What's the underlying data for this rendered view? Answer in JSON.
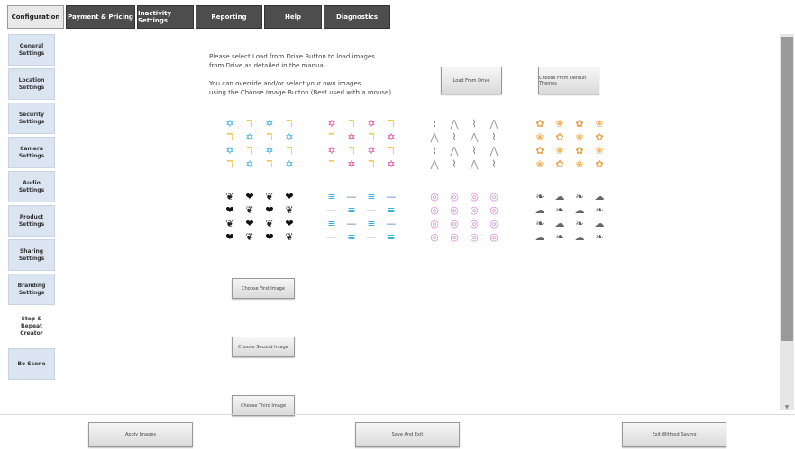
{
  "tabs": [
    {
      "label": "Configuration",
      "active": true
    },
    {
      "label": "Payment & Pricing",
      "active": false
    },
    {
      "label": "Inactivity Settings",
      "active": false
    },
    {
      "label": "Reporting",
      "active": false
    },
    {
      "label": "Help",
      "active": false
    },
    {
      "label": "Diagnostics",
      "active": false
    }
  ],
  "sidebar": {
    "items": [
      {
        "label": "General\nSettings"
      },
      {
        "label": "Location\nSettings"
      },
      {
        "label": "Security\nSettings"
      },
      {
        "label": "Camera\nSettings"
      },
      {
        "label": "Audio\nSettings"
      },
      {
        "label": "Product\nSettings"
      },
      {
        "label": "Sharing\nSettings"
      },
      {
        "label": "Branding\nSettings"
      },
      {
        "label": "Step &\nRepeat\nCreator"
      },
      {
        "label": "Bo Scene"
      }
    ]
  },
  "instructions": {
    "line1": "Please select Load from Drive Button to load images\nfrom Drive as detailed in the manual.",
    "line2": "You can override and/or select your own images\nusing the Choose Image Button (Best used with a mouse)."
  },
  "buttons": {
    "load_from_drive": "Load From Drive",
    "choose_default": "Choose From Default Themes",
    "choose_first": "Choose First Image",
    "choose_second": "Choose Second Image",
    "choose_third": "Choose Third Image",
    "apply_images": "Apply Images",
    "save_and_exit": "Save And Exit",
    "exit_without_saving": "Exit Without Saving"
  },
  "patterns": [
    {
      "glyphs": [
        "✡",
        "ℸ"
      ],
      "color": "#2aa9d6",
      "alt_color": "#f2b81f"
    },
    {
      "glyphs": [
        "✡",
        "ℸ"
      ],
      "color": "#e03ca0",
      "alt_color": "#f2b81f"
    },
    {
      "glyphs": [
        "⌇",
        "⋀"
      ],
      "color": "#777777",
      "alt_color": "#999999"
    },
    {
      "glyphs": [
        "✿",
        "❀"
      ],
      "color": "#e7a24a",
      "alt_color": "#f0b45c"
    },
    {
      "glyphs": [
        "❦",
        "❤"
      ],
      "color": "#222222",
      "alt_color": "#111111"
    },
    {
      "glyphs": [
        "≡",
        "—"
      ],
      "color": "#2aa9d6",
      "alt_color": "#4a7fd0"
    },
    {
      "glyphs": [
        "◎",
        "◎"
      ],
      "color": "#e07ad0",
      "alt_color": "#c78ad8"
    },
    {
      "glyphs": [
        "❧",
        "☁"
      ],
      "color": "#555555",
      "alt_color": "#666666"
    }
  ],
  "colors": {
    "tab_dark": "#4d4d4d",
    "sidebar_bg": "#dbe5f1",
    "scroll_thumb": "#9a9a9a"
  }
}
